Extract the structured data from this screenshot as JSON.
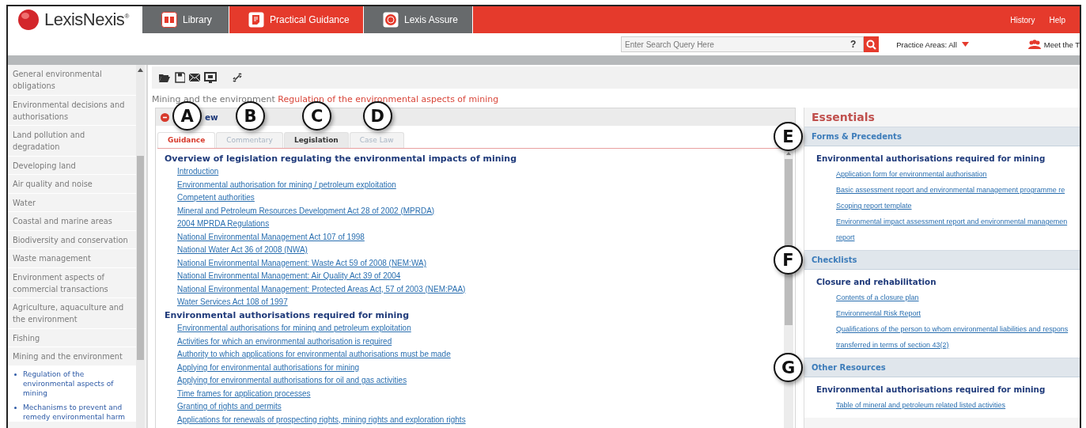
{
  "header": {
    "logo": {
      "name": "LexisNexis",
      "mark": "®"
    },
    "nav_tabs": [
      {
        "label": "Library",
        "selected": false,
        "kind": "book"
      },
      {
        "label": "Practical Guidance",
        "selected": true,
        "kind": "document"
      },
      {
        "label": "Lexis Assure",
        "selected": false,
        "kind": "emblem"
      }
    ],
    "top_links": [
      "History",
      "Help"
    ],
    "search": {
      "placeholder": "Enter Search Query Here",
      "help": "?"
    },
    "practice_areas": "Practice Areas: All",
    "meet": "Meet the T"
  },
  "sidebar": {
    "items": [
      {
        "label": "General environmental obligations"
      },
      {
        "label": "Environmental decisions and authorisations"
      },
      {
        "label": "Land pollution and degradation"
      },
      {
        "label": "Developing land"
      },
      {
        "label": "Air quality and noise"
      },
      {
        "label": "Water"
      },
      {
        "label": "Coastal and marine areas"
      },
      {
        "label": "Biodiversity and conservation"
      },
      {
        "label": "Waste management"
      },
      {
        "label": "Environment aspects of commercial transactions"
      },
      {
        "label": "Agriculture, aquaculture and the environment"
      },
      {
        "label": "Fishing"
      },
      {
        "label": "Mining and the environment",
        "children": [
          {
            "label": "Regulation of the environmental aspects of mining"
          },
          {
            "label": "Mechanisms to prevent and remedy environmental harm"
          }
        ]
      }
    ]
  },
  "breadcrumb": [
    {
      "label": "Mining and the environment",
      "kind": "parent"
    },
    {
      "label": "Regulation of the environmental aspects of mining",
      "kind": "current"
    }
  ],
  "document": {
    "title": "ew",
    "tabs": [
      {
        "label": "Guidance",
        "selected": true,
        "disabled": false,
        "callout": "A"
      },
      {
        "label": "Commentary",
        "selected": false,
        "disabled": true,
        "callout": "B"
      },
      {
        "label": "Legislation",
        "selected": false,
        "disabled": false,
        "callout": "C"
      },
      {
        "label": "Case Law",
        "selected": false,
        "disabled": true,
        "callout": "D"
      }
    ],
    "sections": [
      {
        "heading": "Overview of legislation regulating the environmental impacts of mining",
        "links": [
          "Introduction",
          "Environmental authorisation for mining / petroleum exploitation",
          "Competent authorities",
          "Mineral and Petroleum Resources Development Act 28 of 2002 (MPRDA)",
          "2004 MPRDA Regulations",
          "National Environmental Management Act 107 of 1998",
          "National Water Act 36 of 2008 (NWA)",
          "National Environmental Management: Waste Act 59 of 2008 (NEM:WA)",
          "National Environmental Management: Air Quality Act 39 of 2004",
          "National Environmental Management: Protected Areas Act, 57 of 2003 (NEM:PAA)",
          "Water Services Act 108 of 1997"
        ]
      },
      {
        "heading": "Environmental authorisations required for mining",
        "links": [
          "Environmental authorisations for mining and petroleum exploitation",
          "Activities for which an environmental authorisation is required",
          "Authority to which applications for environmental authorisations must be made",
          "Applying for environmental authorisations for mining",
          "Applying for environmental authorisations for oil and gas activities",
          "Time frames for application processes",
          "Granting of rights and permits",
          "Applications for renewals of prospecting rights, mining rights and exploration rights"
        ]
      }
    ]
  },
  "essentials": {
    "title": "Essentials",
    "sections": [
      {
        "title": "Forms & Precedents",
        "callout": "E",
        "groups": [
          {
            "heading": "Environmental authorisations required for mining",
            "links": [
              "Application form for environmental authorisation",
              "Basic assessment report and environmental management programme re",
              "Scoping report template",
              "Environmental impact assessment report and environmental managemen",
              "report"
            ]
          }
        ]
      },
      {
        "title": "Checklists",
        "callout": "F",
        "groups": [
          {
            "heading": "Closure and rehabilitation",
            "links": [
              "Contents of a closure plan",
              "Environmental Risk Report",
              "Qualifications of the person to whom environmental liabilities and respons",
              "transferred in terms of section 43(2)"
            ]
          }
        ]
      },
      {
        "title": "Other Resources",
        "callout": "G",
        "groups": [
          {
            "heading": "Environmental authorisations required for mining",
            "links": [
              "Table of mineral and petroleum related listed activities"
            ]
          }
        ]
      }
    ]
  }
}
